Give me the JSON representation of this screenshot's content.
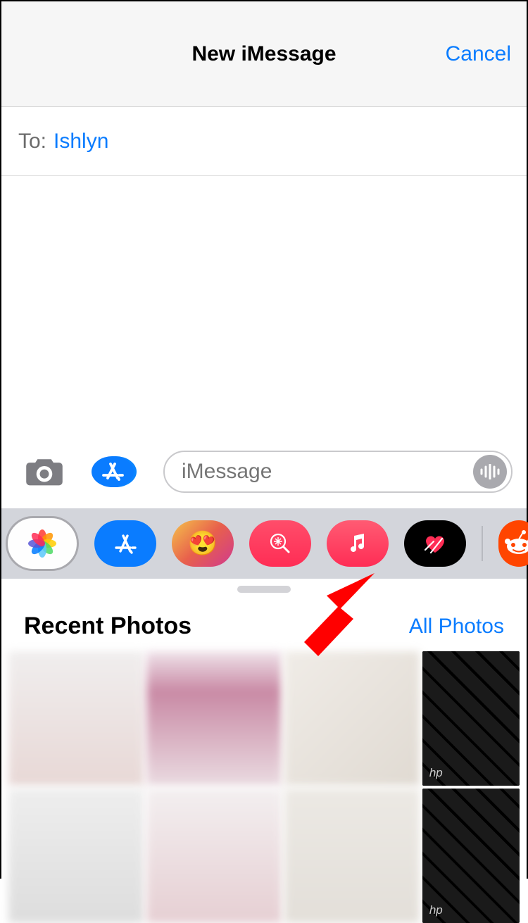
{
  "header": {
    "title": "New iMessage",
    "cancel": "Cancel"
  },
  "to": {
    "label": "To:",
    "recipient": "Ishlyn"
  },
  "compose": {
    "placeholder": "iMessage"
  },
  "app_strip": {
    "icons": [
      {
        "name": "photos-app-icon",
        "selected": true
      },
      {
        "name": "appstore-app-icon"
      },
      {
        "name": "memoji-app-icon"
      },
      {
        "name": "search-images-app-icon"
      },
      {
        "name": "music-app-icon"
      },
      {
        "name": "digital-touch-app-icon"
      },
      {
        "name": "reddit-app-icon"
      }
    ]
  },
  "photos": {
    "recent_title": "Recent Photos",
    "all_photos": "All Photos"
  }
}
